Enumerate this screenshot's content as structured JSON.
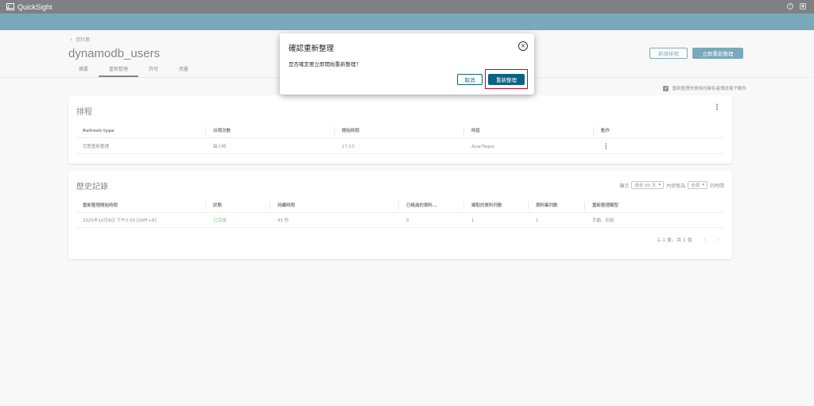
{
  "app": {
    "name": "QuickSight",
    "accent": "#0b6384"
  },
  "header_icons": [
    "help-icon",
    "user-icon"
  ],
  "breadcrumb": {
    "back_icon": "chevron-left-icon",
    "label": "資料集"
  },
  "page": {
    "title": "dynamodb_users"
  },
  "tabs": [
    {
      "label": "摘要"
    },
    {
      "label": "重新整理",
      "active": true
    },
    {
      "label": "許可"
    },
    {
      "label": "用量"
    }
  ],
  "actions": {
    "add_schedule": "新增排程",
    "refresh_now": "立即重新整理"
  },
  "email_option": {
    "label": "重新整理失敗時向擁有者傳送電子郵件",
    "checked": true
  },
  "schedule": {
    "title": "排程",
    "columns": [
      "Refresh type",
      "出現次數",
      "開始時間",
      "時區",
      "動作"
    ],
    "rows": [
      {
        "type": "完整重新整理",
        "occurrence": "每小時",
        "start": "17:13",
        "timezone": "Asia/Taipei",
        "action": "⋮"
      }
    ]
  },
  "history": {
    "title": "歷史記錄",
    "filter": {
      "show_label": "顯示",
      "range": "過去 90 天",
      "status_label": "內狀態為",
      "status": "全部",
      "suffix": "的時間"
    },
    "columns": [
      "重新整理開始時間",
      "狀態",
      "持續時間",
      "已略過的資料...",
      "擷取的資料列數",
      "資料集列數",
      "重新整理類型"
    ],
    "rows": [
      {
        "start": "2025年10月8日 下午2:50 [GMT+8]",
        "status": "已完成",
        "duration": "45 秒",
        "skipped": "0",
        "ingested": "1",
        "dataset_rows": "1",
        "refresh_type": "手動、初始"
      }
    ],
    "status_color": "#1d8102",
    "pagination": {
      "label": "1–1 頁，共 1 頁"
    }
  },
  "modal": {
    "title": "確認重新整理",
    "message": "是否確定要立即開始重新整理？",
    "cancel": "取消",
    "confirm": "重新整理"
  }
}
